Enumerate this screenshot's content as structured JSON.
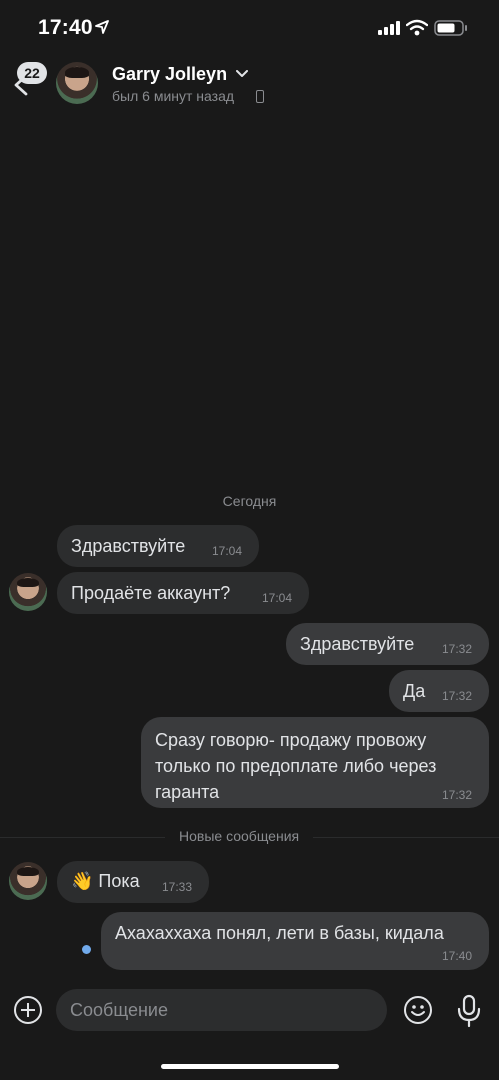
{
  "status": {
    "time": "17:40"
  },
  "header": {
    "unread_count": "22",
    "name": "Garry Jolleyn",
    "last_seen": "был 6 минут назад"
  },
  "chat": {
    "date_separator": "Сегодня",
    "messages": [
      {
        "dir": "in",
        "text": "Здравствуйте",
        "time": "17:04"
      },
      {
        "dir": "in",
        "text": "Продаёте аккаунт?",
        "time": "17:04"
      },
      {
        "dir": "out",
        "text": "Здравствуйте",
        "time": "17:32"
      },
      {
        "dir": "out",
        "text": "Да",
        "time": "17:32"
      },
      {
        "dir": "out",
        "text": "Сразу говорю- продажу провожу только по предоплате либо через гаранта",
        "time": "17:32"
      },
      {
        "dir": "in",
        "text": "👋 Пока",
        "time": "17:33"
      },
      {
        "dir": "out",
        "text": "Ахахаххаха понял, лети в базы, кидала",
        "time": "17:40"
      }
    ],
    "new_messages_label": "Новые сообщения"
  },
  "composer": {
    "placeholder": "Сообщение"
  },
  "colors": {
    "background": "#191919",
    "bubble_in": "#2c2d2e",
    "bubble_out": "#3a3b3d",
    "accent": "#71aaeb"
  }
}
